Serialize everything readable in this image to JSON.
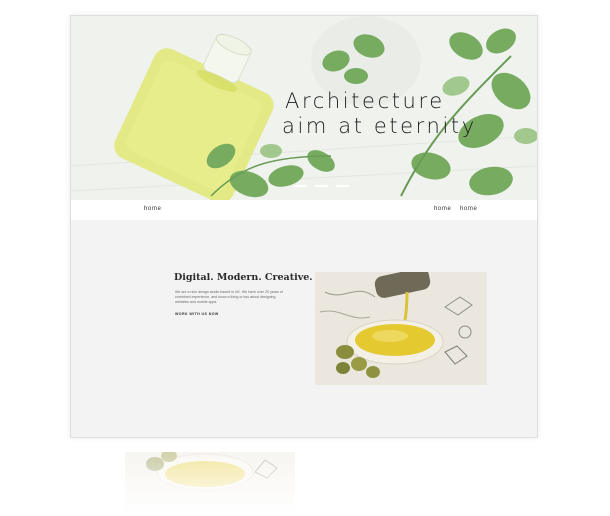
{
  "hero": {
    "title_line1": "Architecture",
    "title_line2": "aim at eternity",
    "slide_count": 3
  },
  "nav": {
    "left_link": "home",
    "right_links": [
      "home",
      "home"
    ]
  },
  "intro": {
    "headline": "Digital. Modern. Creative.",
    "paragraph": "We are a nice design studio based in UK. We have over 20 years of combined experience, and know a thing or two about designing websites and mobile apps.",
    "cta": "WORK WITH US NOW"
  },
  "icons": {
    "hero_image": "oil-bottle-mint-photo",
    "feature_image": "olive-oil-bowl-photo"
  },
  "colors": {
    "background": "#f3f3f3",
    "navbar": "#ffffff",
    "accent_oil": "#d9e24a",
    "leaf": "#5c9b45"
  }
}
